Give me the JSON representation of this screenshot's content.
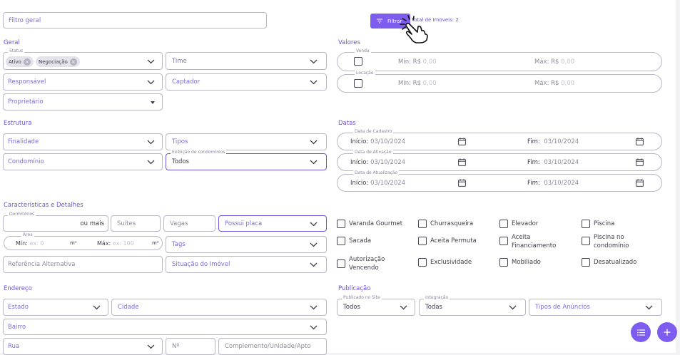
{
  "search": {
    "placeholder": "Filtro geral"
  },
  "toolbar": {
    "filter_button": "Filtrar",
    "total_label": "Total de Imoveis: 2"
  },
  "sections": {
    "geral": "Geral",
    "valores": "Valores",
    "estrutura": "Estrutura",
    "datas": "Datas",
    "caracteristicas": "Caracteristicas e Detalhes",
    "endereco": "Endereço",
    "publicacao": "Publicação"
  },
  "geral": {
    "status_label": "Status",
    "chips": [
      "Ativo",
      "Negociação"
    ],
    "time": "Time",
    "responsavel": "Responsável",
    "captador": "Captador",
    "proprietario": "Proprietário"
  },
  "valores": {
    "venda_label": "Venda",
    "locacao_label": "Locação",
    "min_label": "Mín: R$",
    "max_label": "Máx: R$",
    "amount_placeholder": "0,00"
  },
  "estrutura": {
    "finalidade": "Finalidade",
    "tipos": "Tipos",
    "condominio": "Condomínio",
    "exibicao_label": "Exibição de condomínios",
    "exibicao_value": "Todos"
  },
  "datas": {
    "cadastro_label": "Data de Cadastro",
    "atualizacao_label": "Data de Ativação",
    "atualizacao2_label": "Data de Atualização",
    "inicio_label": "Início:",
    "fim_label": "Fim:",
    "date_value": "03/10/2024"
  },
  "caracteristicas": {
    "dormitorios_label": "Dormitórios",
    "ou_mais": "ou mais",
    "suites": "Suítes",
    "vagas": "Vagas",
    "possui_placa": "Possui placa",
    "area_label": "Área",
    "area_min_label": "Mín:",
    "area_min_ph": "ex: 0",
    "area_max_label": "Máx:",
    "area_max_ph": "ex: 100",
    "unit": "m²",
    "tags": "Tags",
    "referencia": "Referência Alternativa",
    "situacao": "Situação do Imóvel"
  },
  "checkboxes": [
    [
      "Varanda Gourmet",
      "Churrasqueira",
      "Elevador",
      "Piscina"
    ],
    [
      "Sacada",
      "Aceita Permuta",
      "Aceita Financiamento",
      "Piscina no condomínio"
    ],
    [
      "Autorização Vencendo",
      "Exclusividade",
      "Mobiliado",
      "Desatualizado"
    ]
  ],
  "endereco": {
    "estado": "Estado",
    "cidade": "Cidade",
    "bairro": "Bairro",
    "rua": "Rua",
    "numero": "Nº",
    "complemento": "Complemento/Unidade/Apto"
  },
  "publicacao": {
    "site_label": "Publicado no Site",
    "site_value": "Todos",
    "integracao_label": "Integração",
    "integracao_value": "Todas",
    "tipos_anuncios": "Tipos de Anúncios"
  },
  "colors": {
    "accent": "#7d5cf0",
    "section": "#6f55d8",
    "placeholder": "#7b6fd8"
  },
  "icons": [
    "filter-icon",
    "pointer-hand-icon",
    "calendar-icon",
    "chevron-down-icon",
    "list-icon",
    "plus-icon"
  ]
}
